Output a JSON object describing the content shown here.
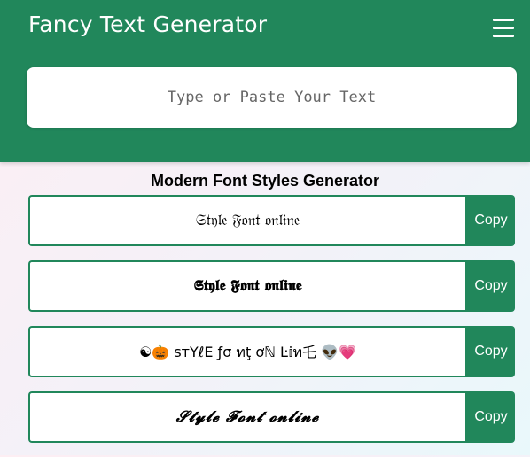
{
  "header": {
    "title": "Fancy Text Generator",
    "menu_icon": "hamburger-menu-icon",
    "background": "#21875b"
  },
  "input": {
    "placeholder": "Type or Paste Your Text",
    "value": ""
  },
  "section": {
    "heading": "Modern Font Styles Generator"
  },
  "styles": [
    {
      "text": "𝔖𝔱𝔶𝔩𝔢 𝔉𝔬𝔫𝔱 𝔬𝔫𝔩𝔦𝔫𝔢",
      "copy_label": "Copy"
    },
    {
      "text": "𝕾𝖙𝖞𝖑𝖊 𝕱𝖔𝖓𝖙 𝖔𝖓𝖑𝖎𝖓𝖊",
      "copy_label": "Copy"
    },
    {
      "text": "☯🎃  ѕтΥℓΕ ƒσ ทţ ơℕ Ŀ𝕚ท乇  👽💗",
      "copy_label": "Copy"
    },
    {
      "text": "𝓢𝓽𝔂𝓵𝓮 𝓕𝓸𝓷𝓽 𝓸𝓷𝓵𝓲𝓷𝓮",
      "copy_label": "Copy"
    }
  ],
  "colors": {
    "accent": "#21875b",
    "surface": "#ffffff"
  }
}
